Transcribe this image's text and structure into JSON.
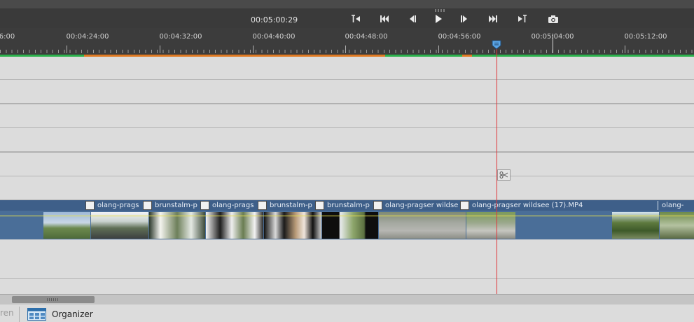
{
  "transport": {
    "timecode": "00:05:00:29",
    "buttons": [
      {
        "name": "goto-start-icon"
      },
      {
        "name": "previous-edit-icon"
      },
      {
        "name": "step-back-icon"
      },
      {
        "name": "play-icon"
      },
      {
        "name": "step-forward-icon"
      },
      {
        "name": "next-edit-icon"
      },
      {
        "name": "goto-end-icon"
      },
      {
        "name": "camera-icon"
      }
    ]
  },
  "ruler": {
    "labels": [
      "6:00",
      "00:04:24:00",
      "00:04:32:00",
      "00:04:40:00",
      "00:04:48:00",
      "00:04:56:00",
      "00:05:04:00",
      "00:05:12:00"
    ]
  },
  "clips": [
    {
      "label": "olang-prags"
    },
    {
      "label": "brunstalm-p"
    },
    {
      "label": "olang-prags"
    },
    {
      "label": "brunstalm-p"
    },
    {
      "label": "brunstalm-p"
    },
    {
      "label": "olang-pragser wildse"
    },
    {
      "label": "olang-pragser wildsee (17).MP4"
    },
    {
      "label": "olang-"
    }
  ],
  "bottombar": {
    "partial_tab": "ren",
    "organizer_label": "Organizer"
  },
  "colors": {
    "playhead": "#e0363a",
    "clip": "#4a6e98",
    "render_ok": "#2bb24c",
    "render_needed": "#e07a22"
  }
}
